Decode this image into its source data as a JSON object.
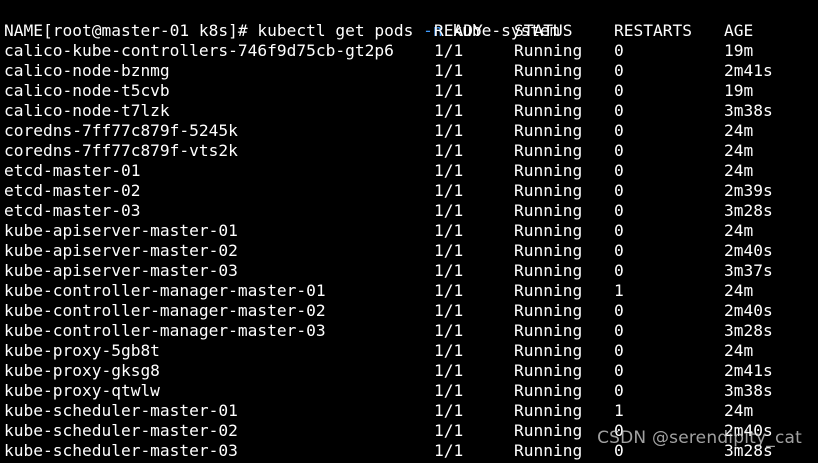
{
  "terminal": {
    "background": "#000000",
    "foreground": "#ffffff",
    "flag_color": "#3f9cff",
    "prompt": "[root@master-01 k8s]#",
    "command_pre": "kubectl get pods",
    "command_flag": "-n",
    "command_post": "kube-system",
    "headers": {
      "name": "NAME",
      "ready": "READY",
      "status": "STATUS",
      "restarts": "RESTARTS",
      "age": "AGE"
    },
    "rows": [
      {
        "name": "calico-kube-controllers-746f9d75cb-gt2p6",
        "ready": "1/1",
        "status": "Running",
        "restarts": "0",
        "age": "19m"
      },
      {
        "name": "calico-node-bznmg",
        "ready": "1/1",
        "status": "Running",
        "restarts": "0",
        "age": "2m41s"
      },
      {
        "name": "calico-node-t5cvb",
        "ready": "1/1",
        "status": "Running",
        "restarts": "0",
        "age": "19m"
      },
      {
        "name": "calico-node-t7lzk",
        "ready": "1/1",
        "status": "Running",
        "restarts": "0",
        "age": "3m38s"
      },
      {
        "name": "coredns-7ff77c879f-5245k",
        "ready": "1/1",
        "status": "Running",
        "restarts": "0",
        "age": "24m"
      },
      {
        "name": "coredns-7ff77c879f-vts2k",
        "ready": "1/1",
        "status": "Running",
        "restarts": "0",
        "age": "24m"
      },
      {
        "name": "etcd-master-01",
        "ready": "1/1",
        "status": "Running",
        "restarts": "0",
        "age": "24m"
      },
      {
        "name": "etcd-master-02",
        "ready": "1/1",
        "status": "Running",
        "restarts": "0",
        "age": "2m39s"
      },
      {
        "name": "etcd-master-03",
        "ready": "1/1",
        "status": "Running",
        "restarts": "0",
        "age": "3m28s"
      },
      {
        "name": "kube-apiserver-master-01",
        "ready": "1/1",
        "status": "Running",
        "restarts": "0",
        "age": "24m"
      },
      {
        "name": "kube-apiserver-master-02",
        "ready": "1/1",
        "status": "Running",
        "restarts": "0",
        "age": "2m40s"
      },
      {
        "name": "kube-apiserver-master-03",
        "ready": "1/1",
        "status": "Running",
        "restarts": "0",
        "age": "3m37s"
      },
      {
        "name": "kube-controller-manager-master-01",
        "ready": "1/1",
        "status": "Running",
        "restarts": "1",
        "age": "24m"
      },
      {
        "name": "kube-controller-manager-master-02",
        "ready": "1/1",
        "status": "Running",
        "restarts": "0",
        "age": "2m40s"
      },
      {
        "name": "kube-controller-manager-master-03",
        "ready": "1/1",
        "status": "Running",
        "restarts": "0",
        "age": "3m28s"
      },
      {
        "name": "kube-proxy-5gb8t",
        "ready": "1/1",
        "status": "Running",
        "restarts": "0",
        "age": "24m"
      },
      {
        "name": "kube-proxy-gksg8",
        "ready": "1/1",
        "status": "Running",
        "restarts": "0",
        "age": "2m41s"
      },
      {
        "name": "kube-proxy-qtwlw",
        "ready": "1/1",
        "status": "Running",
        "restarts": "0",
        "age": "3m38s"
      },
      {
        "name": "kube-scheduler-master-01",
        "ready": "1/1",
        "status": "Running",
        "restarts": "1",
        "age": "24m"
      },
      {
        "name": "kube-scheduler-master-02",
        "ready": "1/1",
        "status": "Running",
        "restarts": "0",
        "age": "2m40s"
      },
      {
        "name": "kube-scheduler-master-03",
        "ready": "1/1",
        "status": "Running",
        "restarts": "0",
        "age": "3m28s"
      }
    ]
  },
  "watermark": "CSDN @serendipity_cat"
}
